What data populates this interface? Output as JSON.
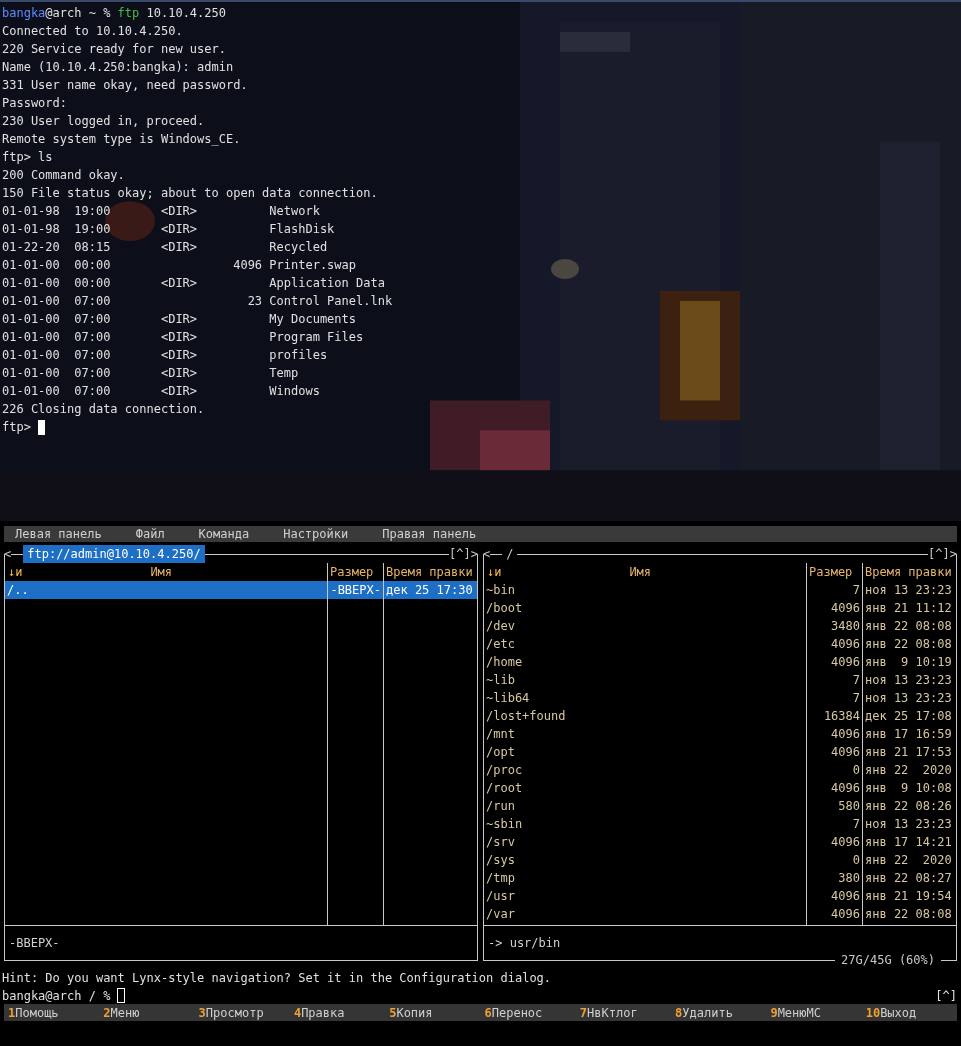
{
  "terminal": {
    "lines": [
      {
        "kind": "shell",
        "segments": [
          {
            "kind": "user",
            "text": "bangka"
          },
          {
            "kind": "plain",
            "text": "@arch ~ % "
          },
          {
            "kind": "command",
            "text": "ftp"
          },
          {
            "kind": "plain",
            "text": " 10.10.4.250"
          }
        ]
      },
      {
        "kind": "text",
        "text": "Connected to 10.10.4.250."
      },
      {
        "kind": "text",
        "text": "220 Service ready for new user."
      },
      {
        "kind": "text",
        "text": "Name (10.10.4.250:bangka): admin"
      },
      {
        "kind": "text",
        "text": "331 User name okay, need password."
      },
      {
        "kind": "text",
        "text": "Password:"
      },
      {
        "kind": "text",
        "text": "230 User logged in, proceed."
      },
      {
        "kind": "text",
        "text": "Remote system type is Windows_CE."
      },
      {
        "kind": "text",
        "text": "ftp> ls"
      },
      {
        "kind": "text",
        "text": "200 Command okay."
      },
      {
        "kind": "text",
        "text": "150 File status okay; about to open data connection."
      },
      {
        "kind": "text",
        "text": "01-01-98  19:00       <DIR>          Network"
      },
      {
        "kind": "text",
        "text": "01-01-98  19:00       <DIR>          FlashDisk"
      },
      {
        "kind": "text",
        "text": "01-22-20  08:15       <DIR>          Recycled"
      },
      {
        "kind": "text",
        "text": "01-01-00  00:00                 4096 Printer.swap"
      },
      {
        "kind": "text",
        "text": "01-01-00  00:00       <DIR>          Application Data"
      },
      {
        "kind": "text",
        "text": "01-01-00  07:00                   23 Control Panel.lnk"
      },
      {
        "kind": "text",
        "text": "01-01-00  07:00       <DIR>          My Documents"
      },
      {
        "kind": "text",
        "text": "01-01-00  07:00       <DIR>          Program Files"
      },
      {
        "kind": "text",
        "text": "01-01-00  07:00       <DIR>          profiles"
      },
      {
        "kind": "text",
        "text": "01-01-00  07:00       <DIR>          Temp"
      },
      {
        "kind": "text",
        "text": "01-01-00  07:00       <DIR>          Windows"
      },
      {
        "kind": "text",
        "text": "226 Closing data connection."
      },
      {
        "kind": "cursor",
        "text": "ftp> "
      }
    ]
  },
  "mc": {
    "menu": [
      "Левая панель",
      "Файл",
      "Команда",
      "Настройки",
      "Правая панель"
    ],
    "panels": [
      {
        "open_mark": "<",
        "path": "ftp://admin@10.10.4.250/",
        "active": true,
        "corner": "[^]",
        "close_mark": ">",
        "sort_indicator": "↓и",
        "columns": [
          "Имя",
          "Размер",
          "Время правки"
        ],
        "rows": [
          {
            "name": "/..",
            "size": "-ВВЕРХ-",
            "time": "дек 25 17:30",
            "selected": true
          }
        ],
        "status": "-ВВЕРХ-"
      },
      {
        "open_mark": "<",
        "path": "/",
        "active": false,
        "corner": "[^]",
        "close_mark": ">",
        "sort_indicator": "↓и",
        "columns": [
          "Имя",
          "Размер",
          "Время правки"
        ],
        "rows": [
          {
            "name": "~bin",
            "size": "7",
            "time": "ноя 13 23:23",
            "selected": false
          },
          {
            "name": "/boot",
            "size": "4096",
            "time": "янв 21 11:12",
            "selected": false
          },
          {
            "name": "/dev",
            "size": "3480",
            "time": "янв 22 08:08",
            "selected": false
          },
          {
            "name": "/etc",
            "size": "4096",
            "time": "янв 22 08:08",
            "selected": false
          },
          {
            "name": "/home",
            "size": "4096",
            "time": "янв  9 10:19",
            "selected": false
          },
          {
            "name": "~lib",
            "size": "7",
            "time": "ноя 13 23:23",
            "selected": false
          },
          {
            "name": "~lib64",
            "size": "7",
            "time": "ноя 13 23:23",
            "selected": false
          },
          {
            "name": "/lost+found",
            "size": "16384",
            "time": "дек 25 17:08",
            "selected": false
          },
          {
            "name": "/mnt",
            "size": "4096",
            "time": "янв 17 16:59",
            "selected": false
          },
          {
            "name": "/opt",
            "size": "4096",
            "time": "янв 21 17:53",
            "selected": false
          },
          {
            "name": "/proc",
            "size": "0",
            "time": "янв 22  2020",
            "selected": false
          },
          {
            "name": "/root",
            "size": "4096",
            "time": "янв  9 10:08",
            "selected": false
          },
          {
            "name": "/run",
            "size": "580",
            "time": "янв 22 08:26",
            "selected": false
          },
          {
            "name": "~sbin",
            "size": "7",
            "time": "ноя 13 23:23",
            "selected": false
          },
          {
            "name": "/srv",
            "size": "4096",
            "time": "янв 17 14:21",
            "selected": false
          },
          {
            "name": "/sys",
            "size": "0",
            "time": "янв 22  2020",
            "selected": false
          },
          {
            "name": "/tmp",
            "size": "380",
            "time": "янв 22 08:27",
            "selected": false
          },
          {
            "name": "/usr",
            "size": "4096",
            "time": "янв 21 19:54",
            "selected": false
          },
          {
            "name": "/var",
            "size": "4096",
            "time": "янв 22 08:08",
            "selected": false
          }
        ],
        "status": "-> usr/bin",
        "disk_usage": "27G/45G (60%)"
      }
    ],
    "hint": "Hint: Do you want Lynx-style navigation? Set it in the Configuration dialog.",
    "prompt": "bangka@arch / %",
    "prompt_corner": "[^]",
    "function_keys": [
      {
        "number": "1",
        "label": "Помощь"
      },
      {
        "number": "2",
        "label": "Меню"
      },
      {
        "number": "3",
        "label": "Просмотр"
      },
      {
        "number": "4",
        "label": "Правка"
      },
      {
        "number": "5",
        "label": "Копия"
      },
      {
        "number": "6",
        "label": "Перенос"
      },
      {
        "number": "7",
        "label": "НвКтлог"
      },
      {
        "number": "8",
        "label": "Удалить"
      },
      {
        "number": "9",
        "label": "МенюМС"
      },
      {
        "number": "10",
        "label": "Выход"
      }
    ]
  }
}
